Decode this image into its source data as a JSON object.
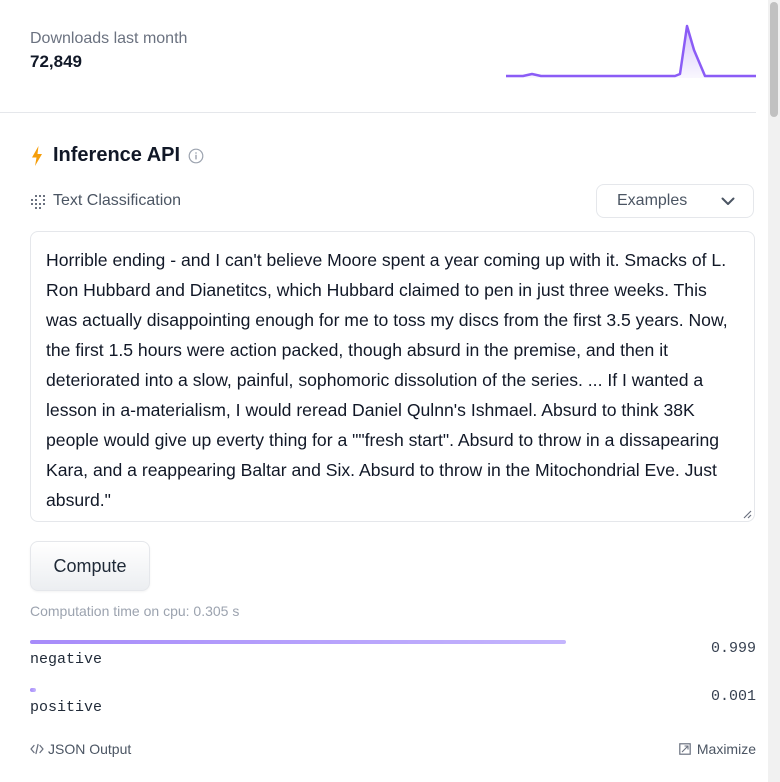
{
  "downloads": {
    "label": "Downloads last month",
    "value": "72,849"
  },
  "inference": {
    "title": "Inference API",
    "task": "Text Classification",
    "examples_label": "Examples",
    "input_text": "Horrible ending - and I can't believe Moore spent a year coming up with it. Smacks of L. Ron Hubbard and Dianetitcs, which Hubbard claimed to pen in just three weeks. This was actually disappointing enough for me to toss my discs from the first 3.5 years. Now, the first 1.5 hours were action packed, though absurd in the premise, and then it deteriorated into a slow, painful, sophomoric dissolution of the series. ... If I wanted a lesson in a-materialism, I would reread Daniel Qulnn's Ishmael. Absurd to think 38K people would give up everty thing for a \"\"fresh start\". Absurd to throw in a dissapearing Kara, and a reappearing Baltar and Six. Absurd to throw in the Mitochondrial Eve. Just absurd.\"",
    "compute_label": "Compute",
    "computation_time": "Computation time on cpu: 0.305 s",
    "results": [
      {
        "label": "negative",
        "score": "0.999",
        "fraction": 0.999
      },
      {
        "label": "positive",
        "score": "0.001",
        "fraction": 0.001
      }
    ],
    "json_output_label": "JSON Output",
    "maximize_label": "Maximize"
  },
  "colors": {
    "accent": "#8b5cf6",
    "bolt": "#f59e0b"
  }
}
